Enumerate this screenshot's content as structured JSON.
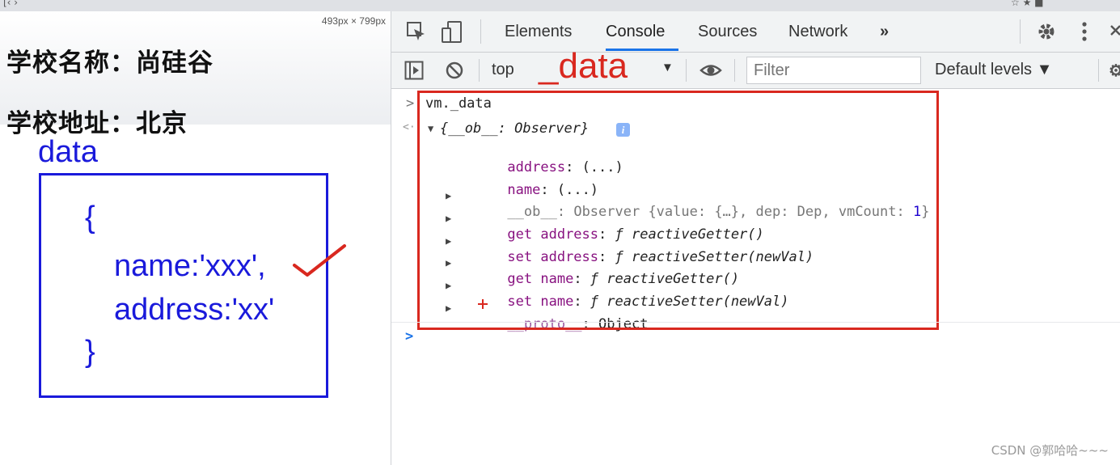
{
  "browser_strip": {
    "left_text": "[‹ ›",
    "right_text": "☆ ★ ■"
  },
  "page": {
    "size_indicator": "493px × 799px",
    "school_name_line": "学校名称：尚硅谷",
    "school_address_line": "学校地址：北京"
  },
  "annotation": {
    "data_label": "data",
    "open_brace": "{",
    "name_line": "name:'xxx',",
    "address_line": "address:'xx'",
    "close_brace": "}",
    "accent_color": "#1a1adb",
    "check_color": "#d9281f"
  },
  "devtools": {
    "tabs": [
      {
        "label": "Elements"
      },
      {
        "label": "Console",
        "active": true
      },
      {
        "label": "Sources"
      },
      {
        "label": "Network"
      },
      {
        "label": "»"
      }
    ],
    "toolbar": {
      "context": "top",
      "context_dropdown": "▼",
      "overlay_annotation": "_data",
      "filter_placeholder": "Filter",
      "levels": "Default levels ▼"
    },
    "icons": [
      "inspect-icon",
      "device-toggle-icon",
      "gear-icon",
      "kebab-menu-icon",
      "close-icon",
      "sidebar-toggle-icon",
      "clear-console-icon",
      "eye-icon"
    ],
    "accent_color": "#1a73e8",
    "console": {
      "input_prompt": ">",
      "input_expr": "vm._data",
      "result_prefix": "<·",
      "root_expand": "▼",
      "root_summary": "{__ob__: Observer}",
      "info_badge": "i",
      "props": [
        {
          "key": "address",
          "sep": ": ",
          "val": "(...)"
        },
        {
          "key": "name",
          "sep": ": ",
          "val": "(...)"
        }
      ],
      "ob_row": {
        "key": "__ob__",
        "sep": ": ",
        "text1": "Observer {value: {…}, dep: Dep, vmCount: ",
        "count": "1",
        "text2": "}"
      },
      "getters": [
        {
          "key": "get address",
          "sep": ": ",
          "f": "ƒ",
          "fn": "reactiveGetter()"
        },
        {
          "key": "set address",
          "sep": ": ",
          "f": "ƒ",
          "fn": "reactiveSetter(newVal)"
        },
        {
          "key": "get name",
          "sep": ": ",
          "f": "ƒ",
          "fn": "reactiveGetter()"
        },
        {
          "key": "set name",
          "sep": ": ",
          "f": "ƒ",
          "fn": "reactiveSetter(newVal)"
        }
      ],
      "proto_row": {
        "key": "__proto__",
        "sep": ": ",
        "val": "Object"
      },
      "expand_arrow": "▶",
      "next_prompt": ">",
      "annotation_color": "#d9281f"
    }
  },
  "watermark": "CSDN @郭哈哈~~~"
}
